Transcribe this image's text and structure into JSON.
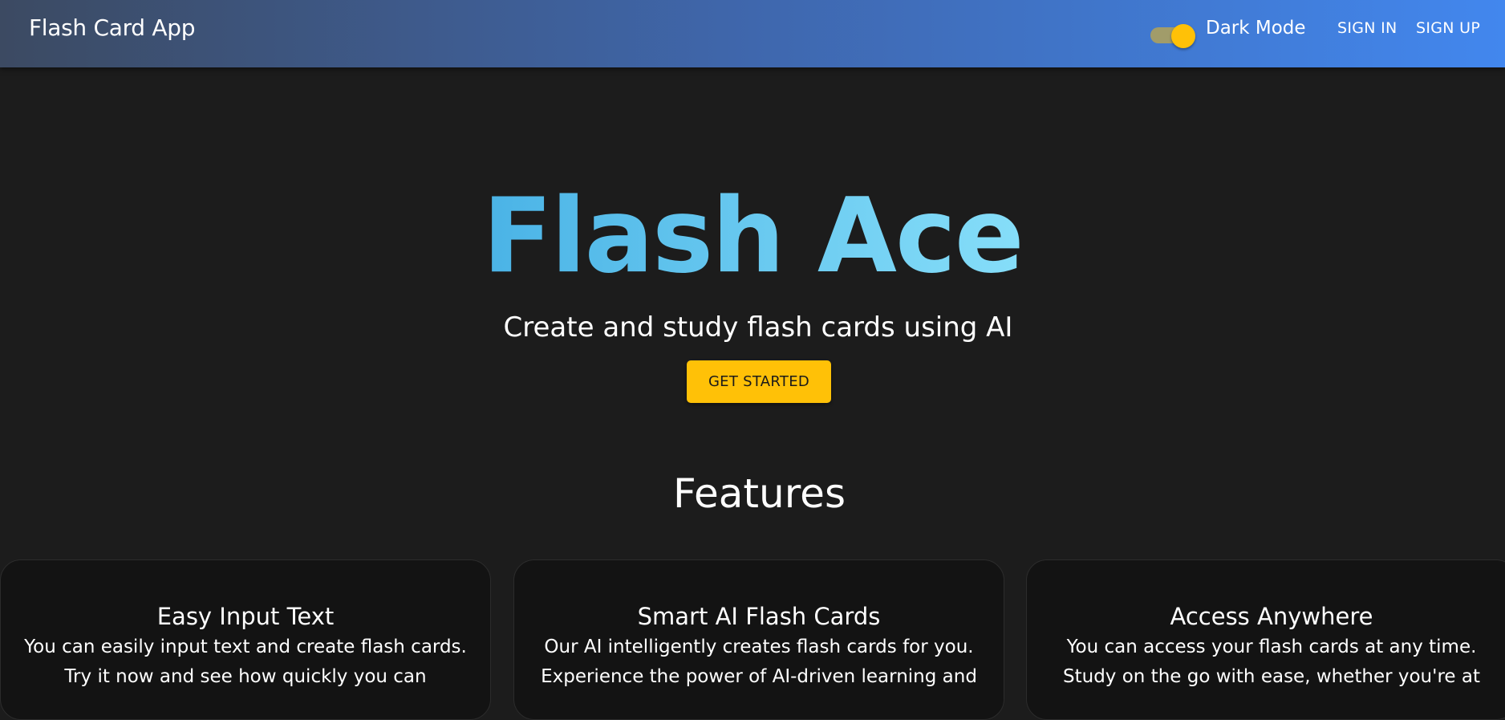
{
  "header": {
    "title": "Flash Card App",
    "dark_mode_label": "Dark Mode",
    "dark_mode_on": true,
    "sign_in": "SIGN IN",
    "sign_up": "SIGN UP"
  },
  "hero": {
    "title": "Flash Ace",
    "subtitle": "Create and study flash cards using AI",
    "cta": "GET STARTED"
  },
  "features": {
    "heading": "Features",
    "cards": [
      {
        "title": "Easy Input Text",
        "body": "You can easily input text and create flash cards. Try it now and see how quickly you can"
      },
      {
        "title": "Smart AI Flash Cards",
        "body": "Our AI intelligently creates flash cards for you. Experience the power of AI-driven learning and"
      },
      {
        "title": "Access Anywhere",
        "body": "You can access your flash cards at any time. Study on the go with ease, whether you're at"
      }
    ]
  },
  "colors": {
    "accent": "#ffc107",
    "header_start": "#3c4a62",
    "header_end": "#4287ee",
    "background": "#1c1c1c"
  }
}
